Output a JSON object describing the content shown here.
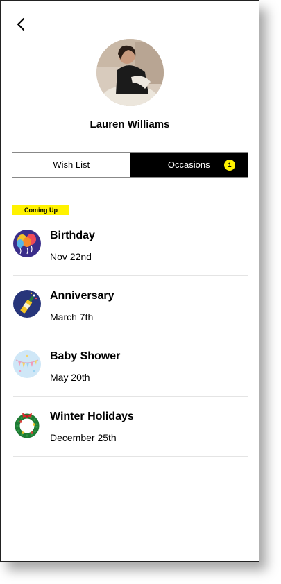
{
  "profile": {
    "name": "Lauren Williams"
  },
  "tabs": [
    {
      "label": "Wish List",
      "active": false
    },
    {
      "label": "Occasions",
      "active": true,
      "badge": "1"
    }
  ],
  "section_label": "Coming Up",
  "occasions": [
    {
      "title": "Birthday",
      "date": "Nov 22nd",
      "icon": "balloons-icon"
    },
    {
      "title": "Anniversary",
      "date": "March 7th",
      "icon": "champagne-icon"
    },
    {
      "title": "Baby Shower",
      "date": "May 20th",
      "icon": "baby-banner-icon"
    },
    {
      "title": "Winter Holidays",
      "date": "December 25th",
      "icon": "wreath-icon"
    }
  ],
  "colors": {
    "accent": "#fff200",
    "active_tab": "#000000"
  }
}
